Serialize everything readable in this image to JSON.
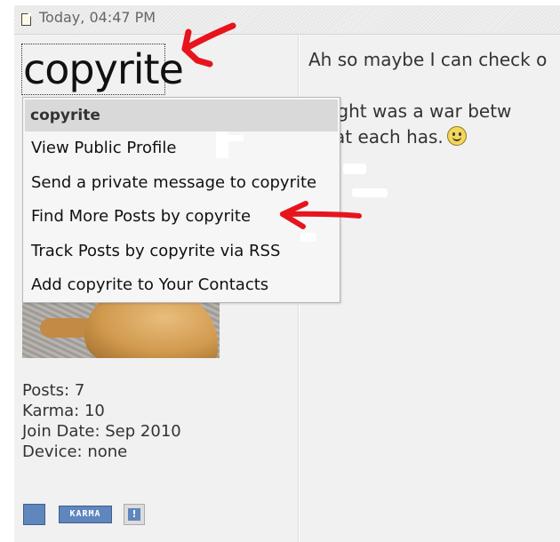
{
  "post": {
    "date": "Today, 04:47 PM"
  },
  "user": {
    "name": "copyrite",
    "stats": [
      "Posts: 7",
      "Karma: 10",
      "Join Date: Sep 2010",
      "Device: none"
    ],
    "karma_button_label": "KARMA",
    "report_button_label": "!"
  },
  "menu": {
    "header": "copyrite",
    "items": [
      "View Public Profile",
      "Send a private message to copyrite",
      "Find More Posts by copyrite",
      "Track Posts by copyrite via RSS",
      "Add copyrite to Your Contacts"
    ]
  },
  "message": {
    "line1": "Ah so maybe I can check o",
    "line2": "t night was a war betw",
    "line3": "what each has."
  },
  "colors": {
    "annotation_red": "#e8141c",
    "button_blue": "#5f86bd",
    "panel_gray": "#f1f1f1"
  },
  "icons": {
    "date": "document-icon",
    "smiley": "smiley-icon",
    "profile_button": "profile-square-icon",
    "report": "report-icon"
  }
}
